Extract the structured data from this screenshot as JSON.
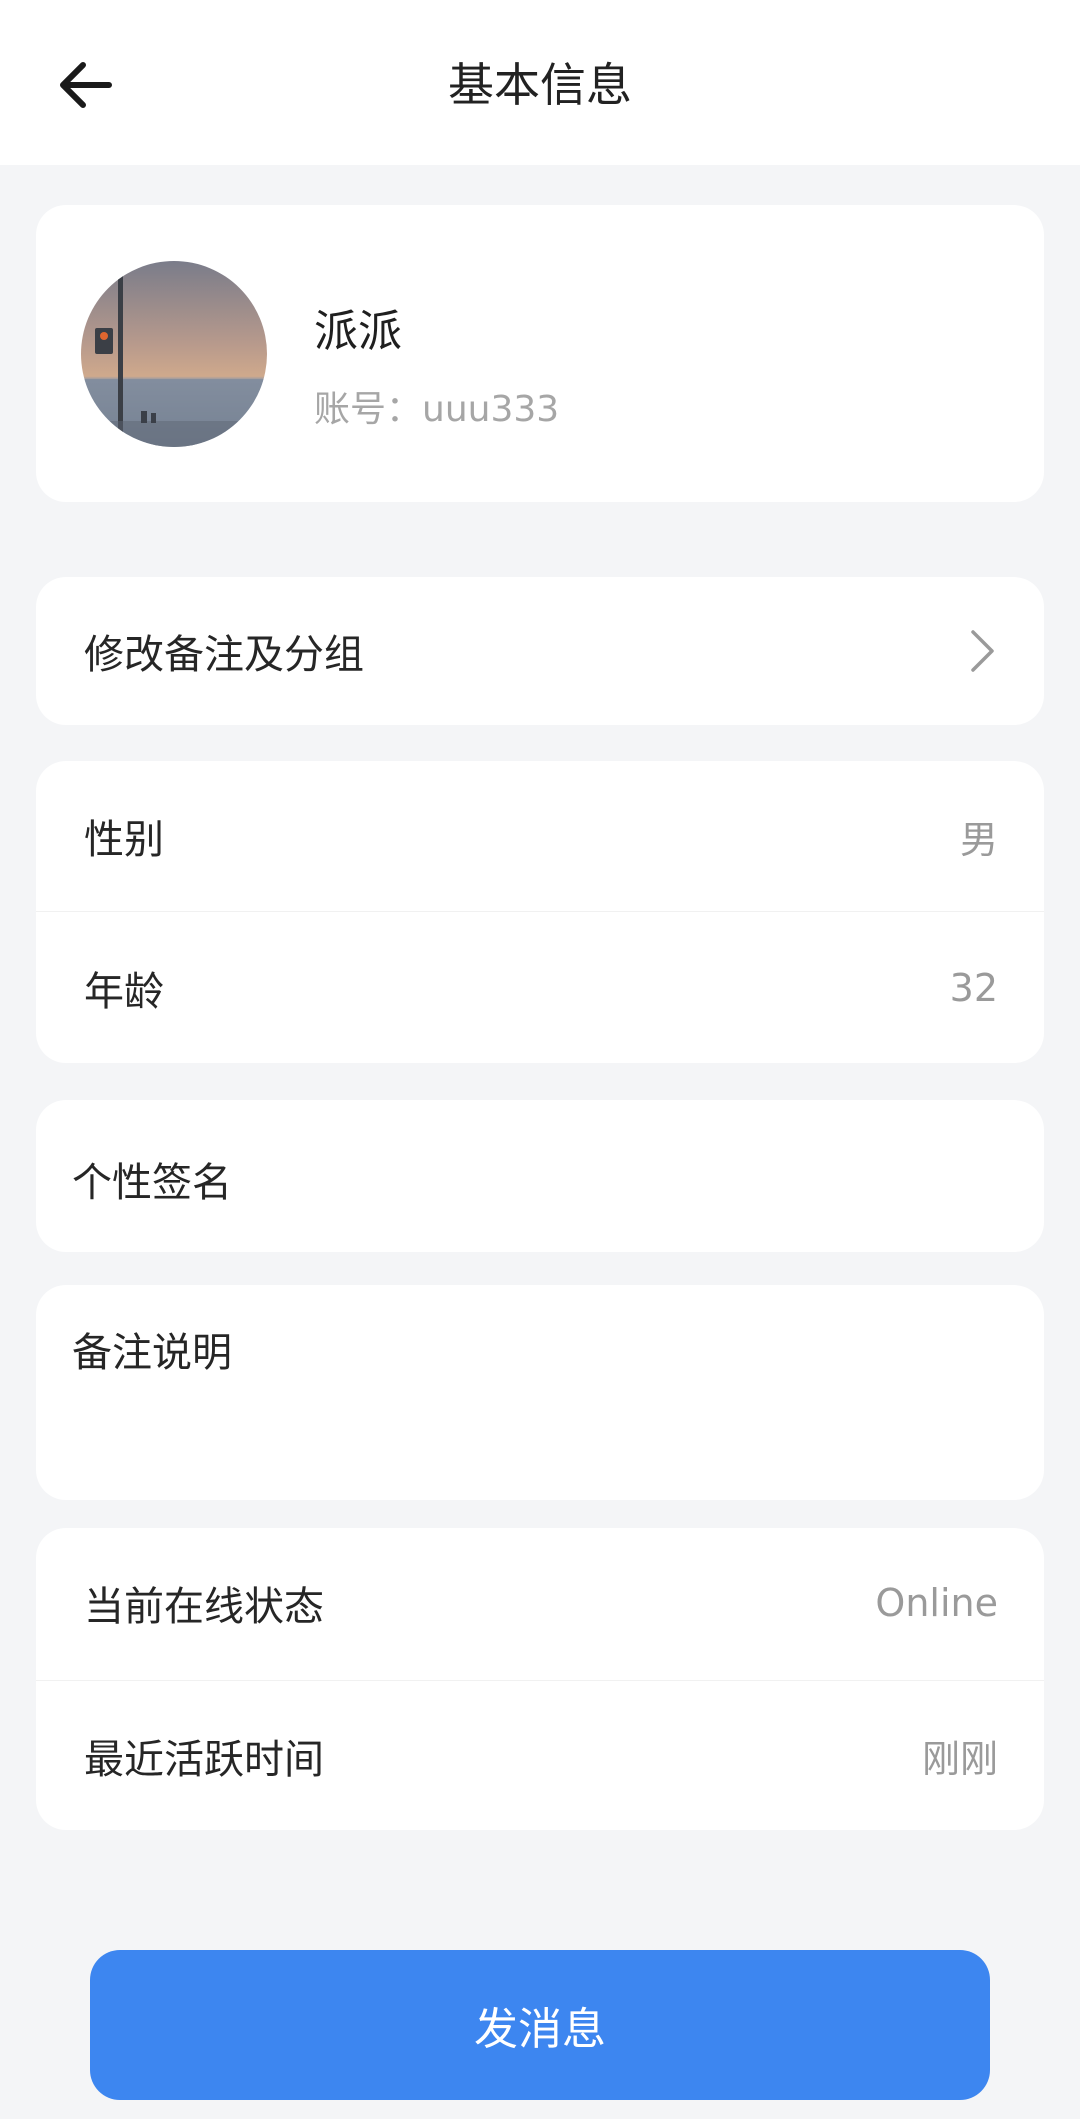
{
  "header": {
    "title": "基本信息"
  },
  "profile": {
    "nickname": "派派",
    "account": "账号：uuu333"
  },
  "remark_row": {
    "label": "修改备注及分组"
  },
  "basic_info": {
    "gender_label": "性别",
    "gender_value": "男",
    "age_label": "年龄",
    "age_value": "32"
  },
  "signature": {
    "label": "个性签名"
  },
  "note": {
    "label": "备注说明"
  },
  "status": {
    "online_label": "当前在线状态",
    "online_value": "Online",
    "active_label": "最近活跃时间",
    "active_value": "刚刚"
  },
  "actions": {
    "send_label": "发消息"
  },
  "colors": {
    "primary": "#3d86f0",
    "background": "#f4f5f7",
    "card": "#ffffff",
    "secondary_text": "#9a9a9a"
  },
  "icons": {
    "back": "arrow-left-icon",
    "chevron": "chevron-right-icon"
  }
}
